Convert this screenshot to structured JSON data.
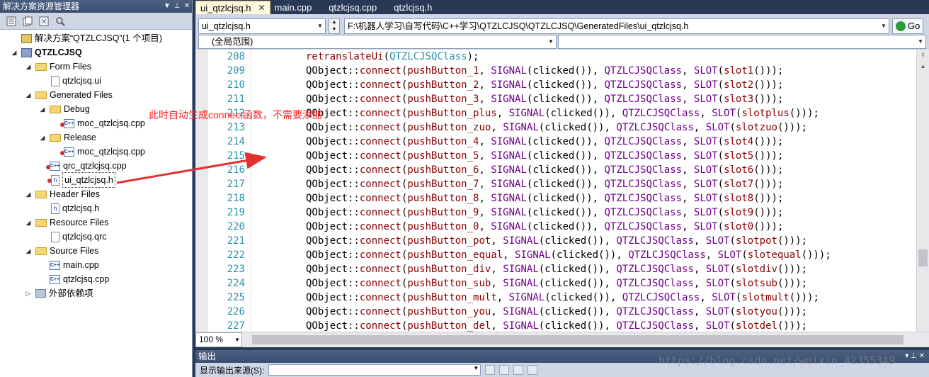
{
  "solution_explorer": {
    "title": "解决方案资源管理器",
    "controls": [
      "▼",
      "⊥",
      "✕"
    ],
    "toolbar_icons": [
      "properties-icon",
      "show-all-files-icon",
      "refresh-icon",
      "view-class-diagram-icon"
    ],
    "tree": [
      {
        "label": "解决方案“QTZLCJSQ”(1 个项目)",
        "indent": 0,
        "icon": "solution-icon",
        "expander": ""
      },
      {
        "label": "QTZLCJSQ",
        "indent": 0,
        "icon": "project-icon",
        "expander": "◢",
        "bold": true
      },
      {
        "label": "Form Files",
        "indent": 1,
        "icon": "folder-icon",
        "expander": "◢"
      },
      {
        "label": "qtzlcjsq.ui",
        "indent": 2,
        "icon": "file-icon",
        "expander": ""
      },
      {
        "label": "Generated Files",
        "indent": 1,
        "icon": "folder-icon",
        "expander": "◢"
      },
      {
        "label": "Debug",
        "indent": 2,
        "icon": "folder-icon",
        "expander": "◢"
      },
      {
        "label": "moc_qtzlcjsq.cpp",
        "indent": 3,
        "icon": "cpp-icon",
        "expander": "",
        "error": true
      },
      {
        "label": "Release",
        "indent": 2,
        "icon": "folder-icon",
        "expander": "◢"
      },
      {
        "label": "moc_qtzlcjsq.cpp",
        "indent": 3,
        "icon": "cpp-icon",
        "expander": "",
        "error": true
      },
      {
        "label": "qrc_qtzlcjsq.cpp",
        "indent": 2,
        "icon": "cpp-icon",
        "expander": "",
        "error": true
      },
      {
        "label": "ui_qtzlcjsq.h",
        "indent": 2,
        "icon": "header-icon",
        "expander": "",
        "error": true,
        "selected": true
      },
      {
        "label": "Header Files",
        "indent": 1,
        "icon": "folder-icon",
        "expander": "◢"
      },
      {
        "label": "qtzlcjsq.h",
        "indent": 2,
        "icon": "header-icon",
        "expander": ""
      },
      {
        "label": "Resource Files",
        "indent": 1,
        "icon": "folder-icon",
        "expander": "◢"
      },
      {
        "label": "qtzlcjsq.qrc",
        "indent": 2,
        "icon": "file-icon",
        "expander": ""
      },
      {
        "label": "Source Files",
        "indent": 1,
        "icon": "folder-icon",
        "expander": "◢"
      },
      {
        "label": "main.cpp",
        "indent": 2,
        "icon": "cpp-icon",
        "expander": ""
      },
      {
        "label": "qtzlcjsq.cpp",
        "indent": 2,
        "icon": "cpp-icon",
        "expander": ""
      },
      {
        "label": "外部依赖项",
        "indent": 1,
        "icon": "references-icon",
        "expander": "▷"
      }
    ]
  },
  "editor": {
    "tabs": [
      {
        "label": "ui_qtzlcjsq.h",
        "active": true,
        "close": "✕"
      },
      {
        "label": "main.cpp",
        "active": false
      },
      {
        "label": "qtzlcjsq.cpp",
        "active": false
      },
      {
        "label": "qtzlcjsq.h",
        "active": false
      }
    ],
    "file_combo": "ui_qtzlcjsq.h",
    "path_combo": "F:\\机器人学习\\自写代码\\C++学习\\QTZLCJSQ\\QTZLCJSQ\\GeneratedFiles\\ui_qtzlcjsq.h",
    "go_label": "Go",
    "scope_combo": "(全局范围)",
    "member_combo": "",
    "zoom": "100 %",
    "lines": [
      {
        "no": "208",
        "parts": [
          [
            "fn",
            "retranslateUi"
          ],
          [
            "plain",
            "("
          ],
          [
            "cls",
            "QTZLCJSQClass"
          ],
          [
            "plain",
            ");"
          ]
        ]
      },
      {
        "no": "209",
        "btn": "pushButton_1",
        "slot": "slot1"
      },
      {
        "no": "210",
        "btn": "pushButton_2",
        "slot": "slot2"
      },
      {
        "no": "211",
        "btn": "pushButton_3",
        "slot": "slot3"
      },
      {
        "no": "212",
        "btn": "pushButton_plus",
        "slot": "slotplus"
      },
      {
        "no": "213",
        "btn": "pushButton_zuo",
        "slot": "slotzuo"
      },
      {
        "no": "214",
        "btn": "pushButton_4",
        "slot": "slot4"
      },
      {
        "no": "215",
        "btn": "pushButton_5",
        "slot": "slot5"
      },
      {
        "no": "216",
        "btn": "pushButton_6",
        "slot": "slot6"
      },
      {
        "no": "217",
        "btn": "pushButton_7",
        "slot": "slot7"
      },
      {
        "no": "218",
        "btn": "pushButton_8",
        "slot": "slot8"
      },
      {
        "no": "219",
        "btn": "pushButton_9",
        "slot": "slot9"
      },
      {
        "no": "220",
        "btn": "pushButton_0",
        "slot": "slot0"
      },
      {
        "no": "221",
        "btn": "pushButton_pot",
        "slot": "slotpot"
      },
      {
        "no": "222",
        "btn": "pushButton_equal",
        "slot": "slotequal"
      },
      {
        "no": "223",
        "btn": "pushButton_div",
        "slot": "slotdiv"
      },
      {
        "no": "224",
        "btn": "pushButton_sub",
        "slot": "slotsub"
      },
      {
        "no": "225",
        "btn": "pushButton_mult",
        "slot": "slotmult"
      },
      {
        "no": "226",
        "btn": "pushButton_you",
        "slot": "slotyou"
      },
      {
        "no": "227",
        "btn": "pushButton_del",
        "slot": "slotdel"
      }
    ],
    "tokens": {
      "qobject": "QObject",
      "scope": "::",
      "connect": "connect",
      "signal": "SIGNAL",
      "clicked": "(clicked())",
      "cls": "QTZLCJSQClass",
      "slot": "SLOT"
    }
  },
  "output": {
    "title": "输出",
    "source_label": "显示输出来源(S):",
    "source_value": "",
    "controls": "▾ ⊥ ✕"
  },
  "annotation": {
    "text": "此时自动生成connect函数，不需要添加",
    "color": "#ff2020"
  },
  "watermark": "https://blog.csdn.net/weixin_42355349"
}
